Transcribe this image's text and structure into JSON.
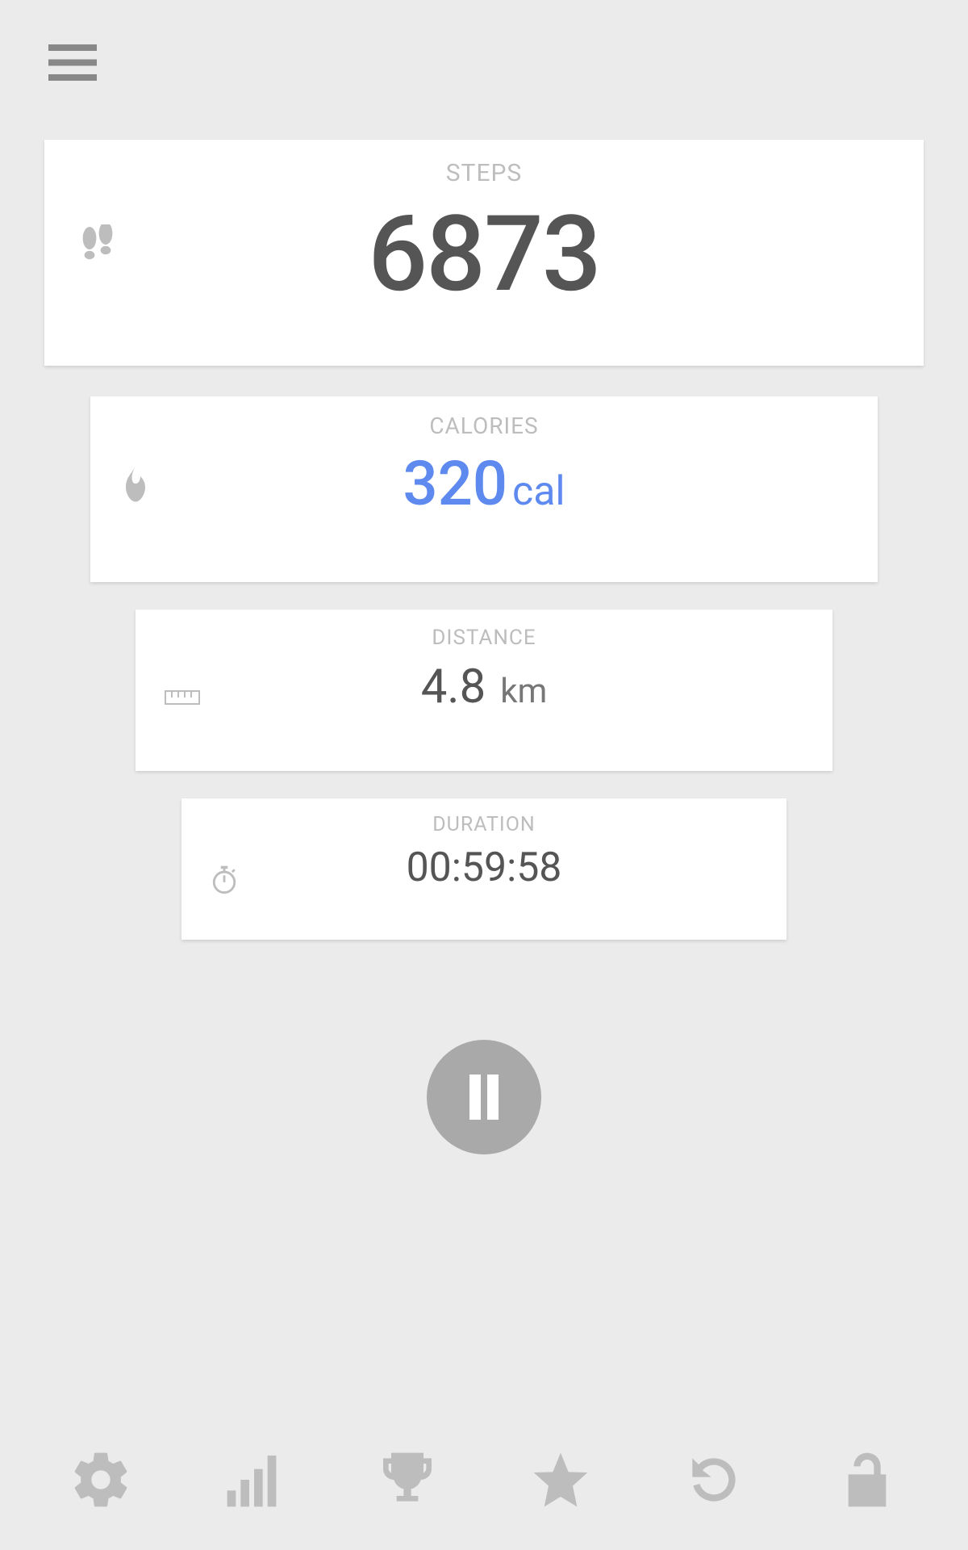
{
  "cards": {
    "steps": {
      "label": "STEPS",
      "value": "6873"
    },
    "calories": {
      "label": "CALORIES",
      "value": "320",
      "unit": "cal"
    },
    "distance": {
      "label": "DISTANCE",
      "value": "4.8",
      "unit": "km"
    },
    "duration": {
      "label": "DURATION",
      "value": "00:59:58"
    }
  }
}
